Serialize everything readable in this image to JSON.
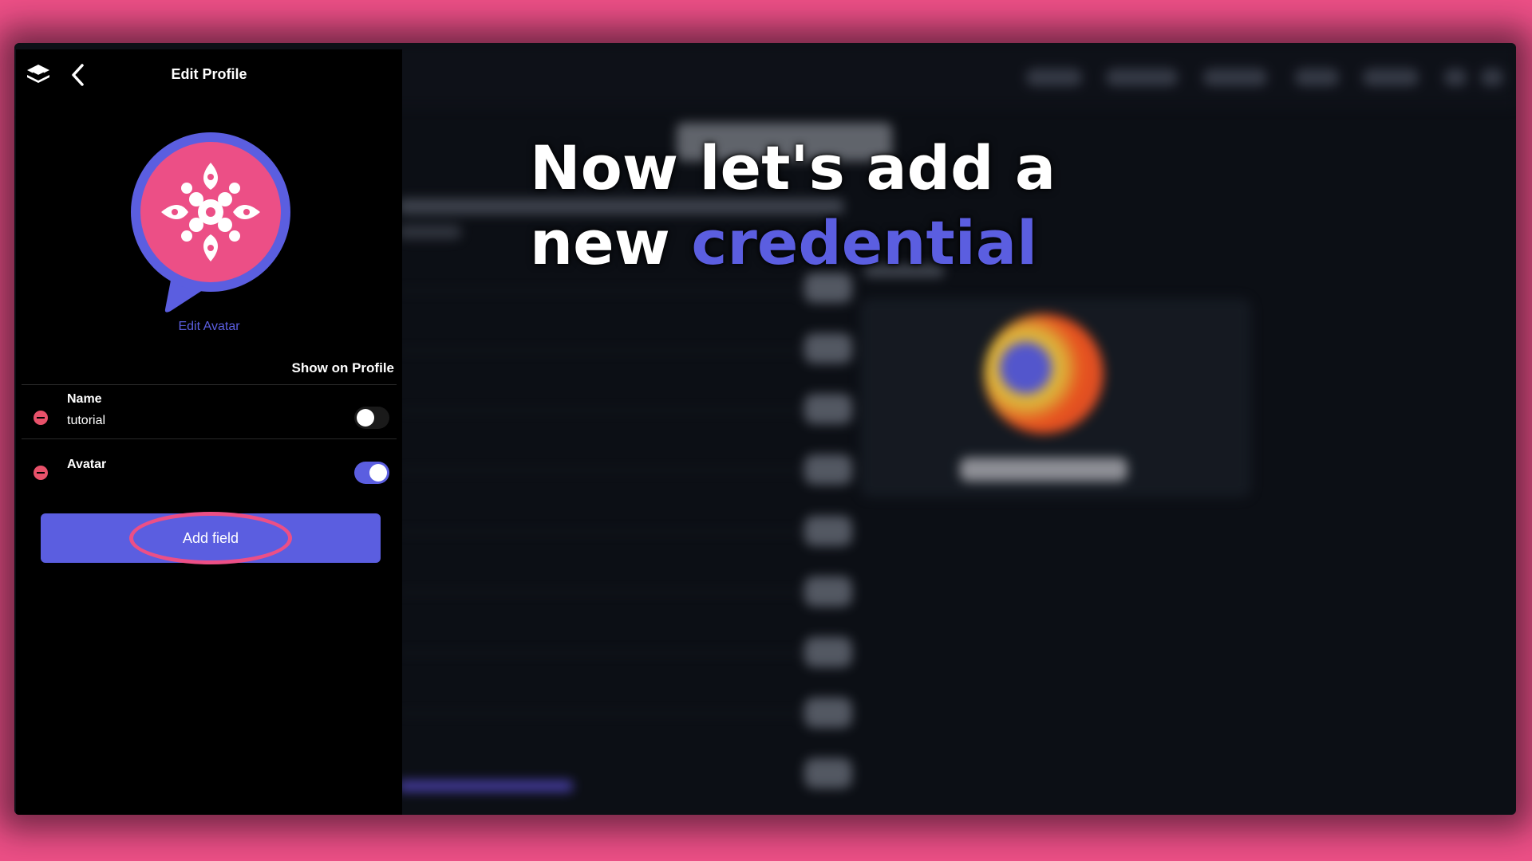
{
  "panel": {
    "title": "Edit Profile",
    "edit_avatar_label": "Edit Avatar",
    "show_on_profile_label": "Show on Profile",
    "fields": [
      {
        "label": "Name",
        "value": "tutorial",
        "show_on_profile": false
      },
      {
        "label": "Avatar",
        "value": "",
        "show_on_profile": true
      }
    ],
    "add_field_label": "Add field"
  },
  "caption": {
    "line1": "Now let's add a",
    "line2_prefix": "new ",
    "line2_highlight": "credential"
  },
  "colors": {
    "accent": "#5b5ee0",
    "brand_pink": "#ec4f86",
    "remove_red": "#e8516a"
  },
  "icons": [
    "logo-icon",
    "back-arrow-icon",
    "avatar-flower-icon",
    "remove-icon"
  ]
}
